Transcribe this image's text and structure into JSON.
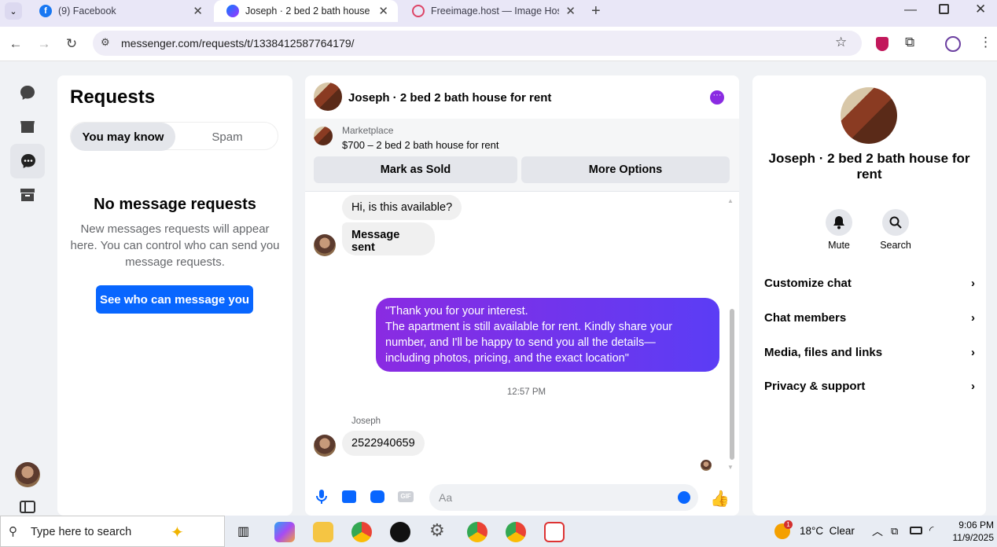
{
  "browser": {
    "tabs": [
      {
        "label": "(9) Facebook",
        "active": false
      },
      {
        "label": "Joseph · 2 bed 2 bath house for rent",
        "active": true
      },
      {
        "label": "Freeimage.host — Image Hosting",
        "active": false
      }
    ],
    "url": "messenger.com/requests/t/1338412587764179/",
    "icons": [
      "back-icon",
      "forward-icon",
      "reload-icon",
      "site-info-icon",
      "star-icon",
      "shield-extension-icon",
      "puzzle-icon",
      "profile-icon",
      "menu-dots-icon"
    ]
  },
  "rail": {
    "icons": [
      "chats-icon",
      "marketplace-icon",
      "requests-icon",
      "archive-icon",
      "user-avatar",
      "sidebar-toggle-icon"
    ]
  },
  "requests": {
    "title": "Requests",
    "tabs": {
      "selected": "You may know",
      "other": "Spam"
    },
    "empty_title": "No message requests",
    "empty_text_1": "New messages requests will appear",
    "empty_text_2": "here. You can control who can send you",
    "empty_text_3": "message requests.",
    "button": "See who can message you"
  },
  "chat": {
    "header_name": "Joseph · 2 bed 2 bath house for rent",
    "marketplace_label": "Marketplace",
    "listing": "$700 – 2 bed 2 bath house for rent",
    "mark_sold": "Mark as Sold",
    "more_options": "More Options",
    "messages": {
      "incoming_1": "Hi, is this available?",
      "incoming_2": "Message sent",
      "outgoing_1": "\"Thank you for your interest.",
      "outgoing_2": "The apartment is still available for rent. Kindly share your",
      "outgoing_3": "number, and I'll be happy to send you all the details—",
      "outgoing_4": "including photos, pricing, and the exact location\"",
      "time": "12:57 PM",
      "sender": "Joseph",
      "incoming_3": "2522940659"
    },
    "composer_placeholder": "Aa",
    "accent": "#7b2ff7"
  },
  "info": {
    "name_1": "Joseph · 2 bed 2 bath house for",
    "name_2": "rent",
    "mute": "Mute",
    "search": "Search",
    "menu": [
      "Customize chat",
      "Chat members",
      "Media, files and links",
      "Privacy & support"
    ]
  },
  "taskbar": {
    "search_placeholder": "Type here to search",
    "weather": "18°C  Clear",
    "weather_badge": "1",
    "time": "9:06 PM",
    "date": "11/9/2025"
  }
}
